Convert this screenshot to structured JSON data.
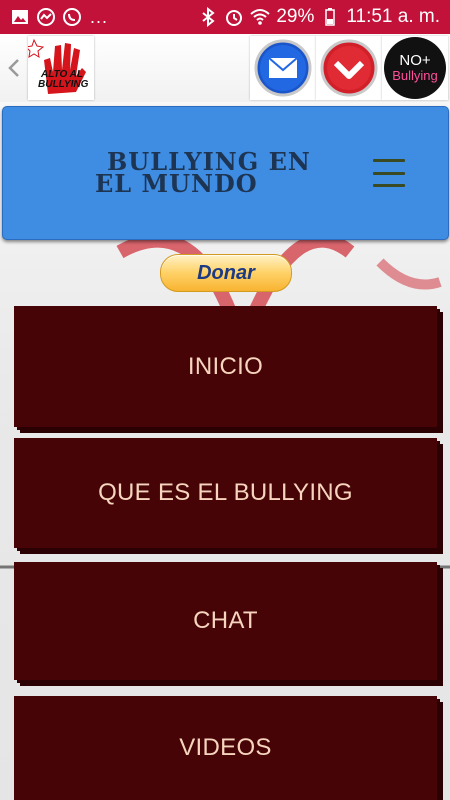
{
  "status_bar": {
    "battery": "29%",
    "time": "11:51 a. m.",
    "more": "...",
    "notification_icons": [
      "image-icon",
      "messenger-icon",
      "whatsapp-icon"
    ],
    "system_icons": [
      "bluetooth-icon",
      "alarm-icon",
      "wifi-icon",
      "battery-icon"
    ],
    "color": "#c2123a"
  },
  "app_bar": {
    "logo": {
      "line1": "ALTO AL",
      "line2": "BULLYING"
    },
    "icons": [
      "back-chevron-icon",
      "mail-icon",
      "red-heart-icon",
      "no-bullying-icon"
    ],
    "no_bullying": {
      "line1": "NO+",
      "line2": "Bullying"
    }
  },
  "header": {
    "title_line1": "BULLYING EN",
    "title_line2": "EL MUNDO",
    "menu_icon": "hamburger-icon",
    "color": "#3f8ce3"
  },
  "donate": {
    "label": "Donar"
  },
  "menu": {
    "color": "#470407",
    "items": [
      {
        "label": "INICIO"
      },
      {
        "label": "QUE ES EL BULLYING"
      },
      {
        "label": "CHAT"
      },
      {
        "label": "VIDEOS"
      }
    ]
  }
}
